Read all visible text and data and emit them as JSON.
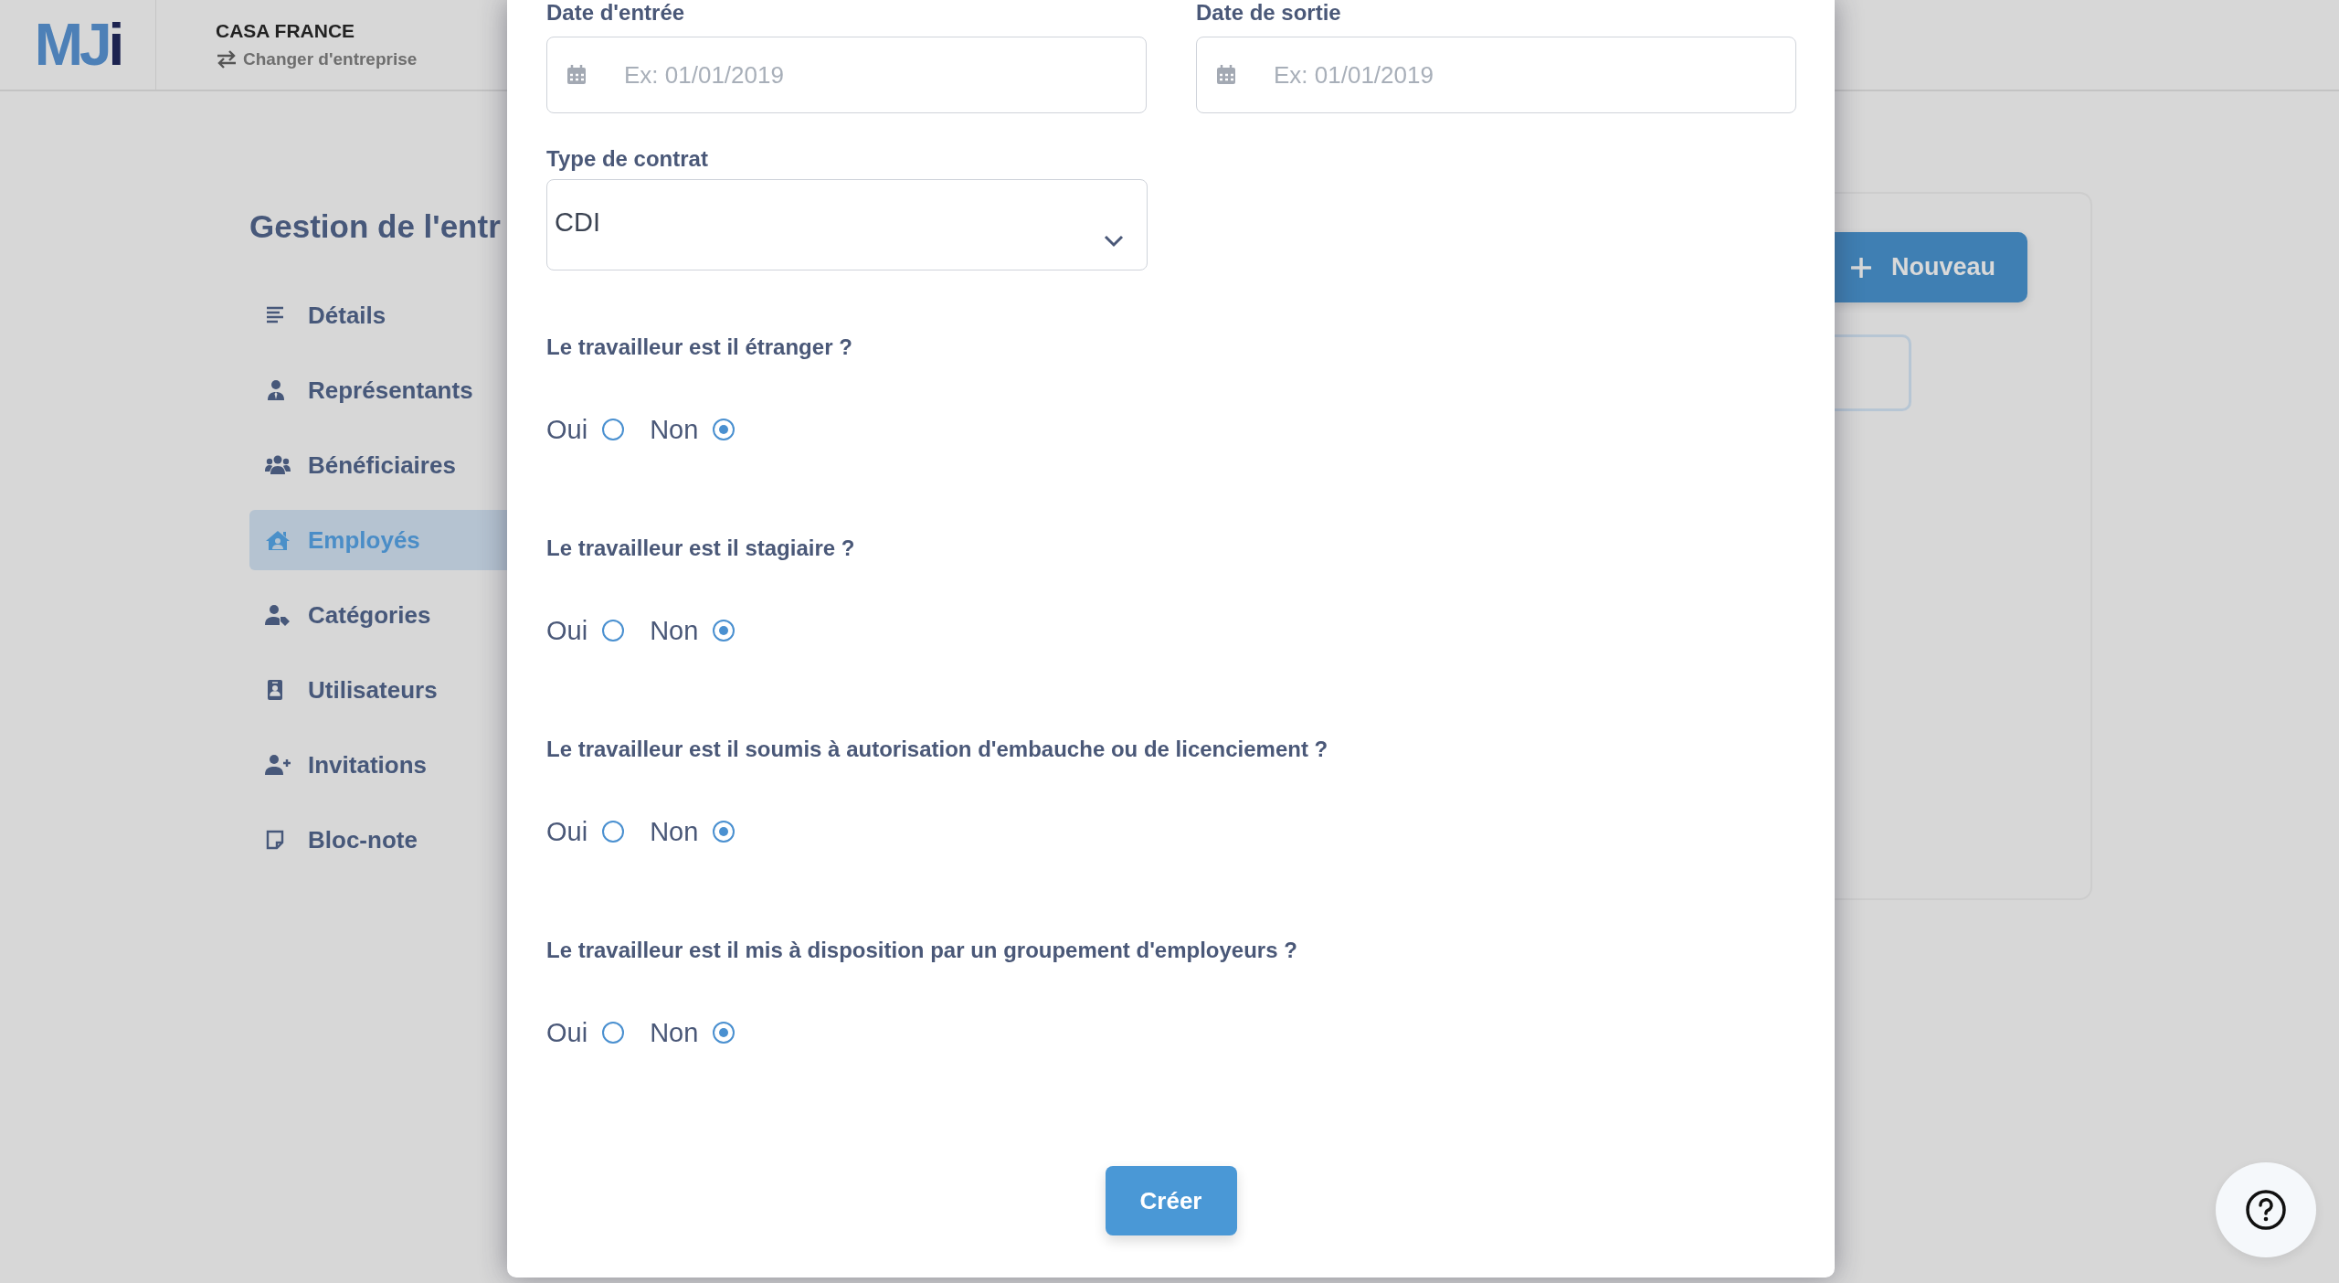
{
  "header": {
    "logo": "MJi",
    "company": "CASA FRANCE",
    "switch_link": "Changer d'entreprise"
  },
  "sidebar": {
    "title": "Gestion de l'entr",
    "items": [
      {
        "label": "Détails",
        "selected": false
      },
      {
        "label": "Représentants",
        "selected": false
      },
      {
        "label": "Bénéficiaires",
        "selected": false
      },
      {
        "label": "Employés",
        "selected": true
      },
      {
        "label": "Catégories",
        "selected": false
      },
      {
        "label": "Utilisateurs",
        "selected": false
      },
      {
        "label": "Invitations",
        "selected": false
      },
      {
        "label": "Bloc-note",
        "selected": false
      }
    ]
  },
  "panel": {
    "new_button": "Nouveau"
  },
  "modal": {
    "date_fields": [
      {
        "label": "Date d'entrée",
        "placeholder": "Ex: 01/01/2019"
      },
      {
        "label": "Date de sortie",
        "placeholder": "Ex: 01/01/2019"
      }
    ],
    "contract": {
      "label": "Type de contrat",
      "value": "CDI"
    },
    "questions": [
      {
        "question": "Le travailleur est il étranger ?",
        "options": [
          {
            "label": "Oui",
            "selected": false
          },
          {
            "label": "Non",
            "selected": true
          }
        ]
      },
      {
        "question": "Le travailleur est il stagiaire ?",
        "options": [
          {
            "label": "Oui",
            "selected": false
          },
          {
            "label": "Non",
            "selected": true
          }
        ]
      },
      {
        "question": "Le travailleur est il soumis à autorisation d'embauche ou de licenciement ?",
        "options": [
          {
            "label": "Oui",
            "selected": false
          },
          {
            "label": "Non",
            "selected": true
          }
        ]
      },
      {
        "question": "Le travailleur est il mis à disposition par un groupement d'employeurs ?",
        "options": [
          {
            "label": "Oui",
            "selected": false
          },
          {
            "label": "Non",
            "selected": true
          }
        ]
      }
    ],
    "submit": "Créer"
  }
}
